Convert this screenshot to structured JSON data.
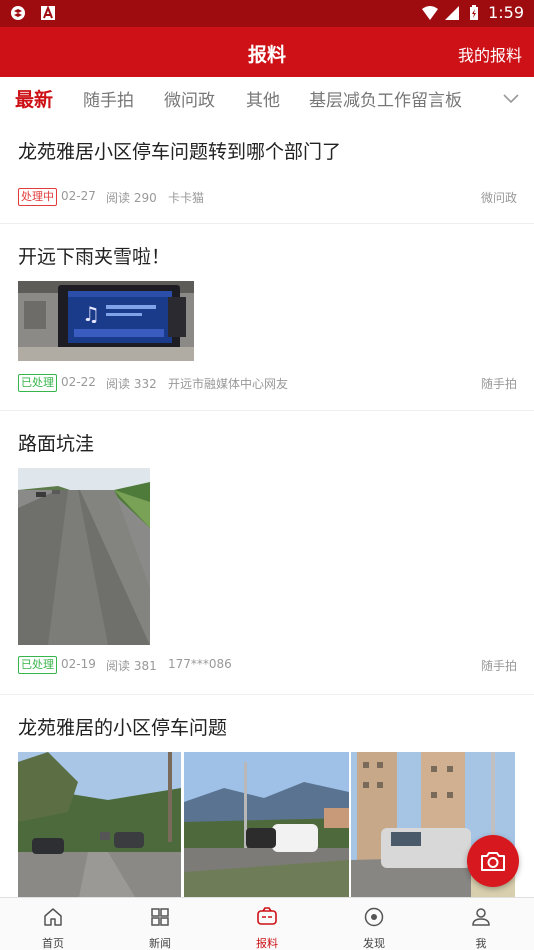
{
  "status_bar": {
    "time": "1:59"
  },
  "header": {
    "title": "报料",
    "action": "我的报料"
  },
  "tabs": [
    "最新",
    "随手拍",
    "微问政",
    "其他",
    "基层减负工作留言板"
  ],
  "items": [
    {
      "title": "龙苑雅居小区停车问题转到哪个部门了",
      "status": "处理中",
      "date": "02-27",
      "reads": "阅读 290",
      "author": "卡卡猫",
      "category": "微问政"
    },
    {
      "title": "开远下雨夹雪啦！",
      "status": "已处理",
      "date": "02-22",
      "reads": "阅读 332",
      "author": "开远市融媒体中心网友",
      "category": "随手拍"
    },
    {
      "title": "路面坑洼",
      "status": "已处理",
      "date": "02-19",
      "reads": "阅读 381",
      "author": "177***086",
      "category": "随手拍"
    },
    {
      "title": "龙苑雅居的小区停车问题"
    }
  ],
  "bottom_nav": [
    {
      "label": "首页",
      "icon": "home-icon"
    },
    {
      "label": "新闻",
      "icon": "grid-icon"
    },
    {
      "label": "报料",
      "icon": "report-icon"
    },
    {
      "label": "发现",
      "icon": "discover-icon"
    },
    {
      "label": "我",
      "icon": "user-icon"
    }
  ],
  "colors": {
    "brand_red": "#cd1116",
    "status_bar": "#9e0c10",
    "processing_red": "#e23b3b",
    "done_green": "#37b44a"
  }
}
